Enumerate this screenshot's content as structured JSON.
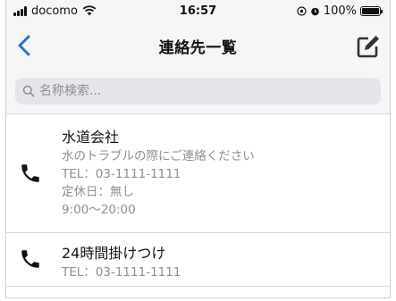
{
  "status_bar": {
    "carrier": "docomo",
    "time": "16:57",
    "battery": "100%",
    "battery_level": 1.0,
    "icons": [
      "signal-icon",
      "wifi-icon",
      "location-icon",
      "alarm-icon",
      "battery-icon"
    ]
  },
  "nav": {
    "title": "連絡先一覧",
    "back_icon": "chevron-left-icon",
    "compose_icon": "compose-icon"
  },
  "search": {
    "placeholder": "名称検索...",
    "value": ""
  },
  "contacts": [
    {
      "name": "水道会社",
      "lines": [
        "水のトラブルの際にご連絡ください",
        "TEL：03-1111-1111",
        "定休日：無し",
        "9:00〜20:00"
      ],
      "icon": "phone-icon"
    },
    {
      "name": "24時間掛けつけ",
      "lines": [
        "TEL：03-1111-1111"
      ],
      "icon": "phone-icon"
    }
  ],
  "colors": {
    "accent": "#2d6fd6",
    "bar_bg": "#f6f6f8",
    "secondary_text": "#8e8e93",
    "search_bg": "#e6e6ea"
  }
}
